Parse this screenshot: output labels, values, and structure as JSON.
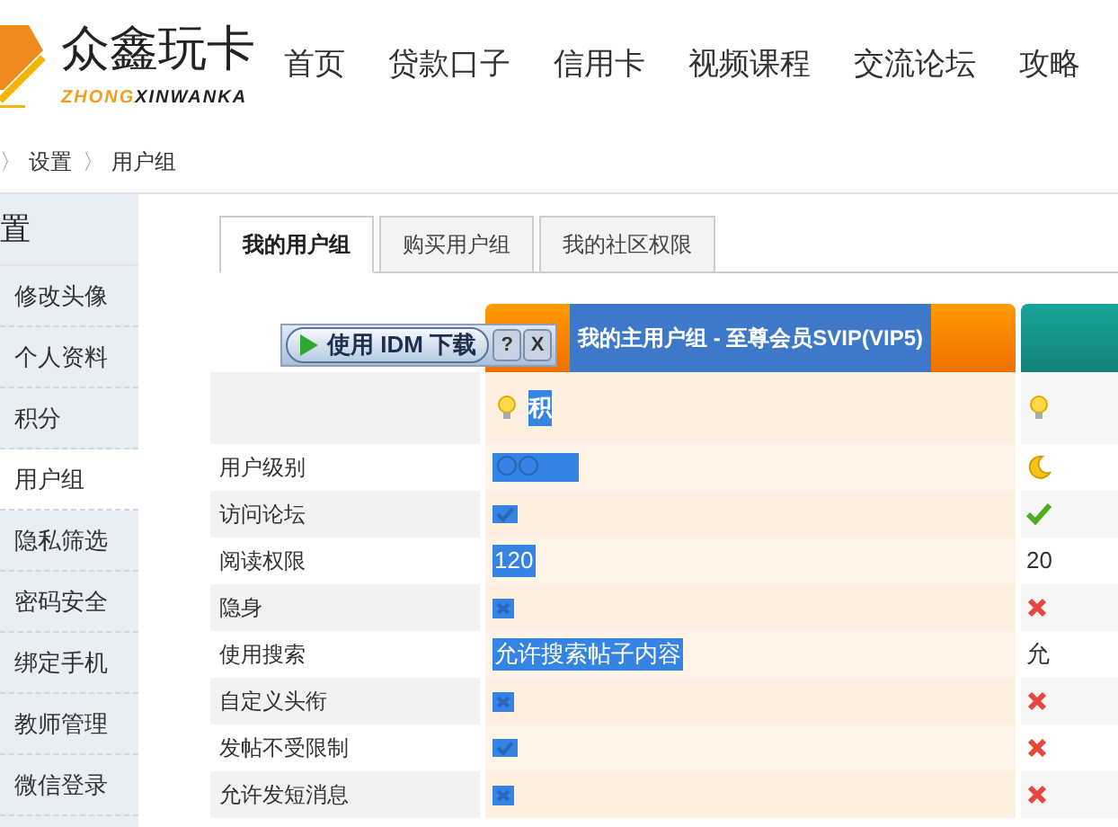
{
  "logo": {
    "name": "众鑫玩卡",
    "pinyin_a": "ZHONG",
    "pinyin_b": "XINWANKA"
  },
  "nav": [
    "首页",
    "贷款口子",
    "信用卡",
    "视频课程",
    "交流论坛",
    "攻略"
  ],
  "breadcrumb": [
    {
      "sep": "〉",
      "label": "设置"
    },
    {
      "sep": "〉",
      "label": "用户组"
    }
  ],
  "sidebar": {
    "title": "置",
    "items": [
      {
        "label": "修改头像",
        "selected": false
      },
      {
        "label": "个人资料",
        "selected": false
      },
      {
        "label": "积分",
        "selected": false
      },
      {
        "label": "用户组",
        "selected": true
      },
      {
        "label": "隐私筛选",
        "selected": false
      },
      {
        "label": "密码安全",
        "selected": false
      },
      {
        "label": "绑定手机",
        "selected": false
      },
      {
        "label": "教师管理",
        "selected": false
      },
      {
        "label": "微信登录",
        "selected": false
      }
    ]
  },
  "tabs": [
    {
      "label": "我的用户组",
      "selected": true
    },
    {
      "label": "购买用户组",
      "selected": false
    },
    {
      "label": "我的社区权限",
      "selected": false
    }
  ],
  "idm": {
    "label": "使用 IDM 下载",
    "help": "?",
    "close": "X"
  },
  "row_labels": [
    "用户级别",
    "访问论坛",
    "阅读权限",
    "隐身",
    "使用搜索",
    "自定义头衔",
    "发帖不受限制",
    "允许发短消息"
  ],
  "columns": [
    {
      "title": "我的主用户组 - 至尊会员SVIP(VIP5)",
      "highlighted": true,
      "points": "积",
      "cells": [
        {
          "kind": "level"
        },
        {
          "kind": "check"
        },
        {
          "kind": "text",
          "text": "120"
        },
        {
          "kind": "cross"
        },
        {
          "kind": "text",
          "text": "允许搜索帖子内容"
        },
        {
          "kind": "cross"
        },
        {
          "kind": "check"
        },
        {
          "kind": "cross"
        }
      ]
    },
    {
      "highlighted": false,
      "cells": [
        {
          "kind": "moon"
        },
        {
          "kind": "check"
        },
        {
          "kind": "text",
          "text": "20"
        },
        {
          "kind": "cross"
        },
        {
          "kind": "text",
          "text": "允"
        },
        {
          "kind": "cross"
        },
        {
          "kind": "cross"
        },
        {
          "kind": "cross"
        }
      ]
    }
  ]
}
